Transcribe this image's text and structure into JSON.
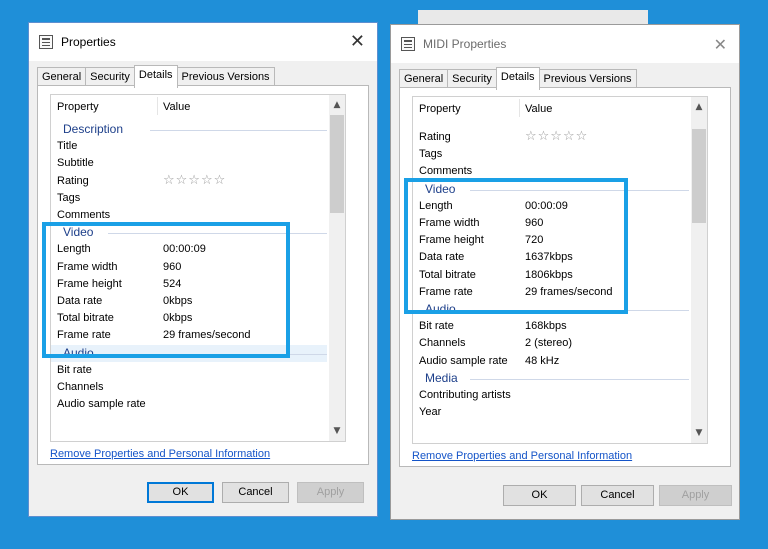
{
  "left": {
    "title": "Properties",
    "tabs": [
      "General",
      "Security",
      "Details",
      "Previous Versions"
    ],
    "header": {
      "property": "Property",
      "value": "Value"
    },
    "rows": [
      {
        "type": "group",
        "label": "Description"
      },
      {
        "type": "item",
        "label": "Title",
        "value": ""
      },
      {
        "type": "item",
        "label": "Subtitle",
        "value": ""
      },
      {
        "type": "item",
        "label": "Rating",
        "value": "☆☆☆☆☆",
        "stars": true
      },
      {
        "type": "item",
        "label": "Tags",
        "value": ""
      },
      {
        "type": "item",
        "label": "Comments",
        "value": ""
      },
      {
        "type": "group",
        "label": "Video"
      },
      {
        "type": "item",
        "label": "Length",
        "value": "00:00:09"
      },
      {
        "type": "item",
        "label": "Frame width",
        "value": "960"
      },
      {
        "type": "item",
        "label": "Frame height",
        "value": "524"
      },
      {
        "type": "item",
        "label": "Data rate",
        "value": "0kbps"
      },
      {
        "type": "item",
        "label": "Total bitrate",
        "value": "0kbps"
      },
      {
        "type": "item",
        "label": "Frame rate",
        "value": "29 frames/second"
      },
      {
        "type": "group",
        "label": "Audio",
        "selected": true
      },
      {
        "type": "item",
        "label": "Bit rate",
        "value": ""
      },
      {
        "type": "item",
        "label": "Channels",
        "value": ""
      },
      {
        "type": "item",
        "label": "Audio sample rate",
        "value": ""
      }
    ],
    "remove_link": "Remove Properties and Personal Information",
    "buttons": {
      "ok": "OK",
      "cancel": "Cancel",
      "apply": "Apply"
    }
  },
  "right": {
    "title": "MIDI Properties",
    "tabs": [
      "General",
      "Security",
      "Details",
      "Previous Versions"
    ],
    "header": {
      "property": "Property",
      "value": "Value"
    },
    "rows": [
      {
        "type": "item",
        "label": "Rating",
        "value": "☆☆☆☆☆",
        "stars": true
      },
      {
        "type": "item",
        "label": "Tags",
        "value": ""
      },
      {
        "type": "item",
        "label": "Comments",
        "value": ""
      },
      {
        "type": "group",
        "label": "Video"
      },
      {
        "type": "item",
        "label": "Length",
        "value": "00:00:09"
      },
      {
        "type": "item",
        "label": "Frame width",
        "value": "960"
      },
      {
        "type": "item",
        "label": "Frame height",
        "value": "720"
      },
      {
        "type": "item",
        "label": "Data rate",
        "value": "1637kbps"
      },
      {
        "type": "item",
        "label": "Total bitrate",
        "value": "1806kbps"
      },
      {
        "type": "item",
        "label": "Frame rate",
        "value": "29 frames/second"
      },
      {
        "type": "group",
        "label": "Audio"
      },
      {
        "type": "item",
        "label": "Bit rate",
        "value": "168kbps"
      },
      {
        "type": "item",
        "label": "Channels",
        "value": "2 (stereo)"
      },
      {
        "type": "item",
        "label": "Audio sample rate",
        "value": "48 kHz"
      },
      {
        "type": "group",
        "label": "Media"
      },
      {
        "type": "item",
        "label": "Contributing artists",
        "value": ""
      },
      {
        "type": "item",
        "label": "Year",
        "value": ""
      }
    ],
    "remove_link": "Remove Properties and Personal Information",
    "buttons": {
      "ok": "OK",
      "cancel": "Cancel",
      "apply": "Apply"
    }
  },
  "colors": {
    "background": "#1f8fd8",
    "highlight": "#1aa0e6",
    "link": "#1454c8",
    "group_text": "#1d3f8a"
  },
  "icons": {
    "app": "properties-sheet-icon",
    "close": "close-icon",
    "scroll_up": "chevron-up-icon",
    "scroll_down": "chevron-down-icon"
  }
}
